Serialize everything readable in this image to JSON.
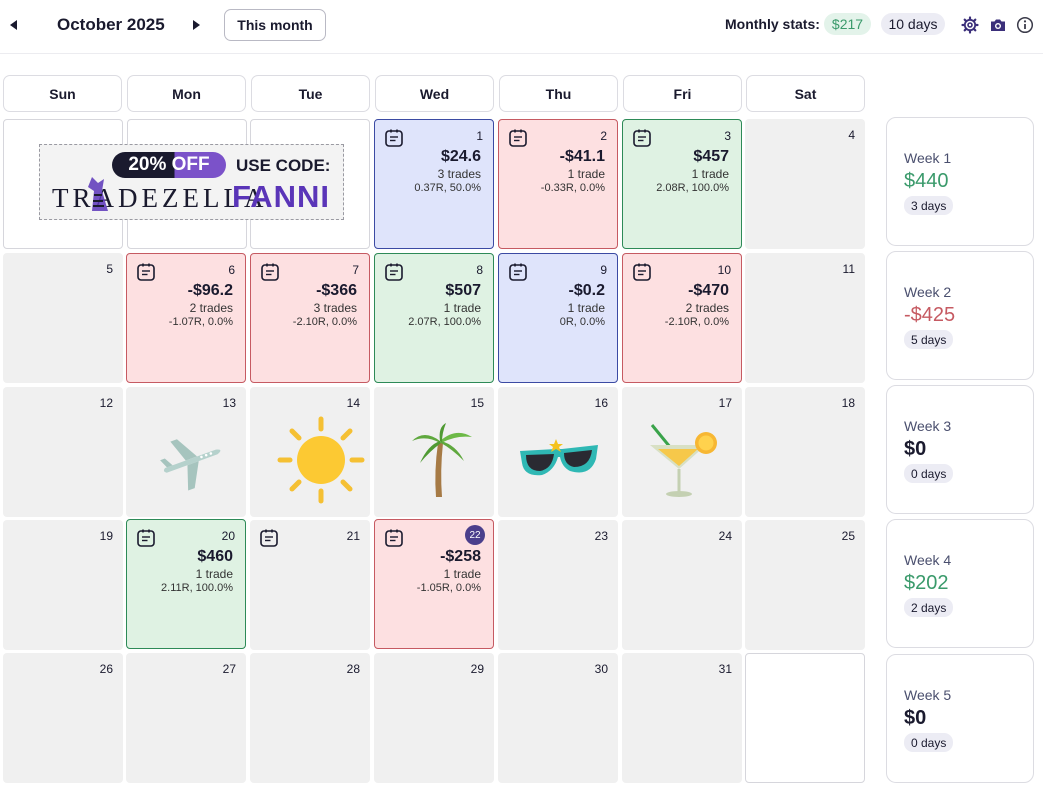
{
  "header": {
    "month_title": "October 2025",
    "this_month_label": "This month",
    "stats_label": "Monthly stats:",
    "stats_profit": "$217",
    "stats_days": "10 days",
    "icons": [
      "settings-icon",
      "camera-icon",
      "info-icon"
    ]
  },
  "weekdays": [
    "Sun",
    "Mon",
    "Tue",
    "Wed",
    "Thu",
    "Fri",
    "Sat"
  ],
  "banner": {
    "discount": "20% OFF",
    "use_code": "USE CODE:",
    "brand": "TRADEZELLA",
    "code": "FANNI"
  },
  "days": {
    "d1": {
      "num": "1",
      "pnl": "$24.6",
      "trades": "3 trades",
      "r": "0.37R, 50.0%"
    },
    "d2": {
      "num": "2",
      "pnl": "-$41.1",
      "trades": "1 trade",
      "r": "-0.33R, 0.0%"
    },
    "d3": {
      "num": "3",
      "pnl": "$457",
      "trades": "1 trade",
      "r": "2.08R, 100.0%"
    },
    "d4": {
      "num": "4"
    },
    "d5": {
      "num": "5"
    },
    "d6": {
      "num": "6",
      "pnl": "-$96.2",
      "trades": "2 trades",
      "r": "-1.07R, 0.0%"
    },
    "d7": {
      "num": "7",
      "pnl": "-$366",
      "trades": "3 trades",
      "r": "-2.10R, 0.0%"
    },
    "d8": {
      "num": "8",
      "pnl": "$507",
      "trades": "1 trade",
      "r": "2.07R, 100.0%"
    },
    "d9": {
      "num": "9",
      "pnl": "-$0.2",
      "trades": "1 trade",
      "r": "0R, 0.0%"
    },
    "d10": {
      "num": "10",
      "pnl": "-$470",
      "trades": "2 trades",
      "r": "-2.10R, 0.0%"
    },
    "d11": {
      "num": "11"
    },
    "d12": {
      "num": "12"
    },
    "d13": {
      "num": "13"
    },
    "d14": {
      "num": "14"
    },
    "d15": {
      "num": "15"
    },
    "d16": {
      "num": "16"
    },
    "d17": {
      "num": "17"
    },
    "d18": {
      "num": "18"
    },
    "d19": {
      "num": "19"
    },
    "d20": {
      "num": "20",
      "pnl": "$460",
      "trades": "1 trade",
      "r": "2.11R, 100.0%"
    },
    "d21": {
      "num": "21"
    },
    "d22": {
      "num": "22",
      "pnl": "-$258",
      "trades": "1 trade",
      "r": "-1.05R, 0.0%"
    },
    "d23": {
      "num": "23"
    },
    "d24": {
      "num": "24"
    },
    "d25": {
      "num": "25"
    },
    "d26": {
      "num": "26"
    },
    "d27": {
      "num": "27"
    },
    "d28": {
      "num": "28"
    },
    "d29": {
      "num": "29"
    },
    "d30": {
      "num": "30"
    },
    "d31": {
      "num": "31"
    }
  },
  "weeks": [
    {
      "name": "Week 1",
      "pnl": "$440",
      "days": "3 days"
    },
    {
      "name": "Week 2",
      "pnl": "-$425",
      "days": "5 days"
    },
    {
      "name": "Week 3",
      "pnl": "$0",
      "days": "0 days"
    },
    {
      "name": "Week 4",
      "pnl": "$202",
      "days": "2 days"
    },
    {
      "name": "Week 5",
      "pnl": "$0",
      "days": "0 days"
    }
  ],
  "colors": {
    "profit": "#3a9a6b",
    "loss": "#c65a62",
    "accent": "#4b3f8c",
    "win_cell": "#dff2e3",
    "loss_cell": "#fde0e1",
    "breakeven_cell": "#dfe4fb"
  },
  "decorations": [
    "airplane-icon",
    "sun-icon",
    "palm-tree-icon",
    "sunglasses-icon",
    "cocktail-icon"
  ]
}
